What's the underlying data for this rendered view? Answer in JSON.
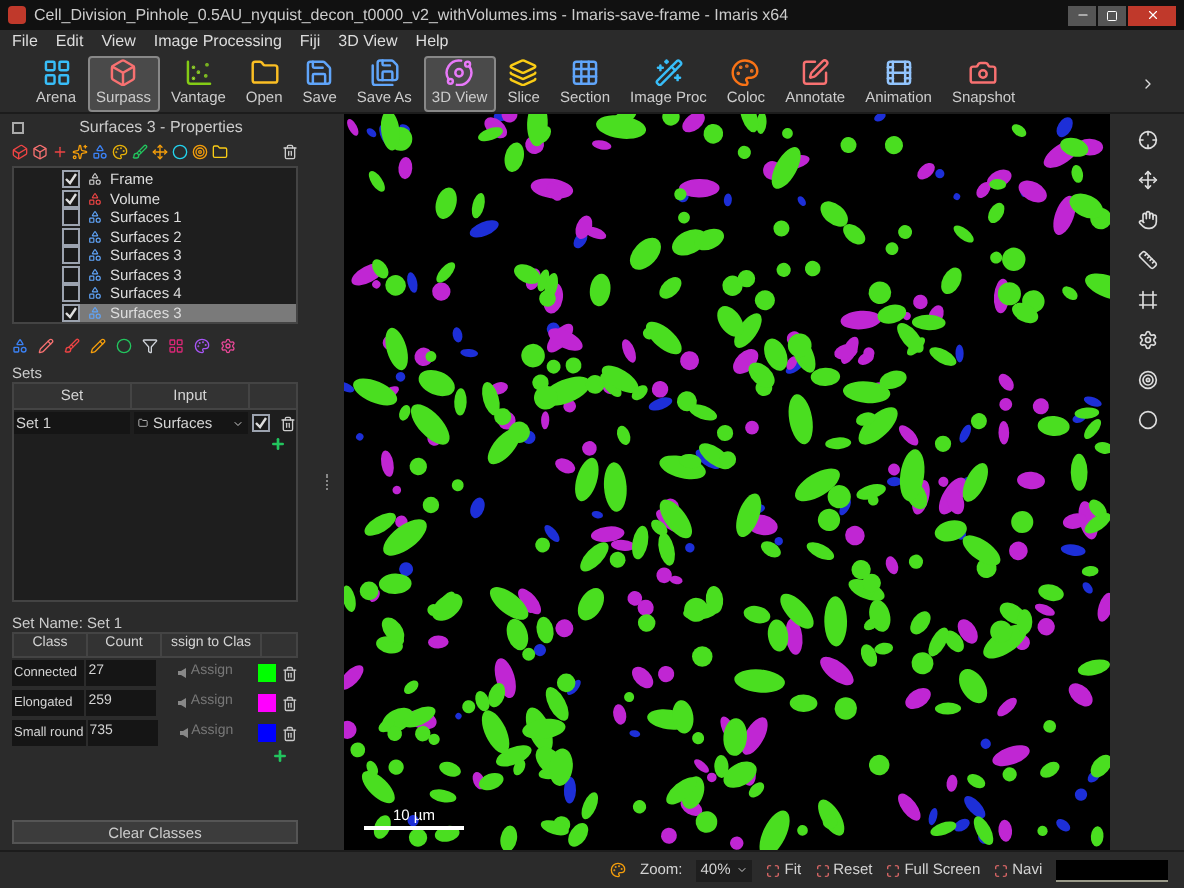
{
  "window": {
    "title": "Cell_Division_Pinhole_0.5AU_nyquist_decon_t0000_v2_withVolumes.ims - Imaris-save-frame - Imaris x64"
  },
  "menu": [
    "File",
    "Edit",
    "View",
    "Image Processing",
    "Fiji",
    "3D View",
    "Help"
  ],
  "toolbar": [
    {
      "label": "Arena",
      "selected": false
    },
    {
      "label": "Surpass",
      "selected": true
    },
    {
      "label": "Vantage",
      "selected": false
    },
    {
      "label": "Open",
      "selected": false
    },
    {
      "label": "Save",
      "selected": false
    },
    {
      "label": "Save As",
      "selected": false
    },
    {
      "label": "3D View",
      "selected": true
    },
    {
      "label": "Slice",
      "selected": false
    },
    {
      "label": "Section",
      "selected": false
    },
    {
      "label": "Image Proc",
      "selected": false
    },
    {
      "label": "Coloc",
      "selected": false
    },
    {
      "label": "Annotate",
      "selected": false
    },
    {
      "label": "Animation",
      "selected": false
    },
    {
      "label": "Snapshot",
      "selected": false
    }
  ],
  "panel": {
    "title": "Surfaces 3 - Properties",
    "tree": [
      {
        "label": "Frame",
        "checked": true,
        "selected": false
      },
      {
        "label": "Volume",
        "checked": true,
        "selected": false
      },
      {
        "label": "Surfaces 1",
        "checked": false,
        "selected": false
      },
      {
        "label": "Surfaces 2",
        "checked": false,
        "selected": false
      },
      {
        "label": "Surfaces 3",
        "checked": false,
        "selected": false
      },
      {
        "label": "Surfaces 3",
        "checked": false,
        "selected": false
      },
      {
        "label": "Surfaces 4",
        "checked": false,
        "selected": false
      },
      {
        "label": "Surfaces 3",
        "checked": true,
        "selected": true
      }
    ],
    "sets_label": "Sets",
    "sets_columns": [
      "Set",
      "Input"
    ],
    "sets": [
      {
        "name": "Set 1",
        "input": "Surfaces",
        "checked": true
      }
    ],
    "set_name": "Set Name: Set 1",
    "class_columns": [
      "Class",
      "Count",
      "ssign to Clas"
    ],
    "classes": [
      {
        "name": "Connected",
        "count": "27",
        "action": "Assign",
        "color": "#00ff00"
      },
      {
        "name": "Elongated",
        "count": "259",
        "action": "Assign",
        "color": "#ff00ff"
      },
      {
        "name": "Small round",
        "count": "735",
        "action": "Assign",
        "color": "#0000ff"
      }
    ],
    "clear_button": "Clear Classes"
  },
  "viewer": {
    "scale_bar": "10 µm"
  },
  "status_bar": {
    "zoom_label": "Zoom:",
    "zoom_value": "40%",
    "buttons": [
      "Fit",
      "Reset",
      "Full Screen",
      "Navi"
    ]
  }
}
